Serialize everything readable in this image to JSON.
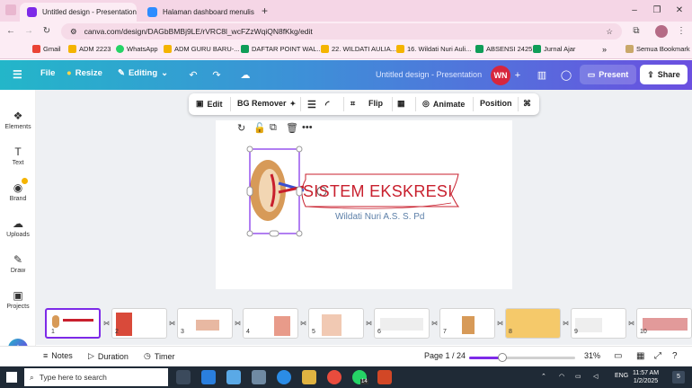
{
  "browser": {
    "tabs": [
      {
        "title": "Untitled design - Presentation",
        "active": true
      },
      {
        "title": "Halaman dashboard menulis",
        "active": false
      }
    ],
    "new_tab": "+",
    "url": "canva.com/design/DAGbBMBj9LE/rVRC8l_wcFZzWqiQN8fKkg/edit",
    "window_controls": {
      "minimize": "–",
      "maximize": "❐",
      "close": "✕"
    },
    "bookmarks": [
      "Gmail",
      "ADM 2223",
      "WhatsApp",
      "ADM GURU BARU-...",
      "DAFTAR POINT WAL...",
      "22. WILDATI AULIA...",
      "16. Wildati Nuri Auli...",
      "ABSENSI 2425",
      "Jurnal Ajar"
    ],
    "more_bookmarks": "»",
    "all_bookmarks": "Semua Bookmark"
  },
  "canva_header": {
    "menu_icon": "☰",
    "file": "File",
    "resize": "Resize",
    "editing": "Editing",
    "doc_title": "Untitled design - Presentation",
    "avatar_initials": "WN",
    "present": "Present",
    "share": "Share"
  },
  "sidebar": {
    "items": [
      {
        "label": "Elements",
        "icon": "elements-icon"
      },
      {
        "label": "Text",
        "icon": "text-icon"
      },
      {
        "label": "Brand",
        "icon": "brand-icon"
      },
      {
        "label": "Uploads",
        "icon": "uploads-icon"
      },
      {
        "label": "Draw",
        "icon": "draw-icon"
      },
      {
        "label": "Projects",
        "icon": "projects-icon"
      }
    ]
  },
  "toolbar": {
    "edit": "Edit",
    "bg_remover": "BG Remover",
    "flip": "Flip",
    "animate": "Animate",
    "position": "Position"
  },
  "slide": {
    "title": "SISTEM EKSKRESI",
    "subtitle": "Wildati Nuri A.S. S. Pd"
  },
  "filmstrip": {
    "pages": [
      "1",
      "2",
      "3",
      "4",
      "5",
      "6",
      "7",
      "8",
      "9",
      "10"
    ],
    "selected": 1
  },
  "bottom_bar": {
    "notes": "Notes",
    "duration": "Duration",
    "timer": "Timer",
    "page_indicator": "Page 1 / 24",
    "zoom": "31%",
    "zoom_fraction": 0.31
  },
  "taskbar": {
    "search_placeholder": "Type here to search",
    "language": "ENG",
    "time": "11:57 AM",
    "date": "1/2/2025",
    "whatsapp_badge": "14",
    "notifications_badge": "5"
  },
  "colors": {
    "accent": "#7d2ae8",
    "title_red": "#c81f2d",
    "subtitle_blue": "#5c7fa8",
    "avatar_red": "#d7263d"
  }
}
